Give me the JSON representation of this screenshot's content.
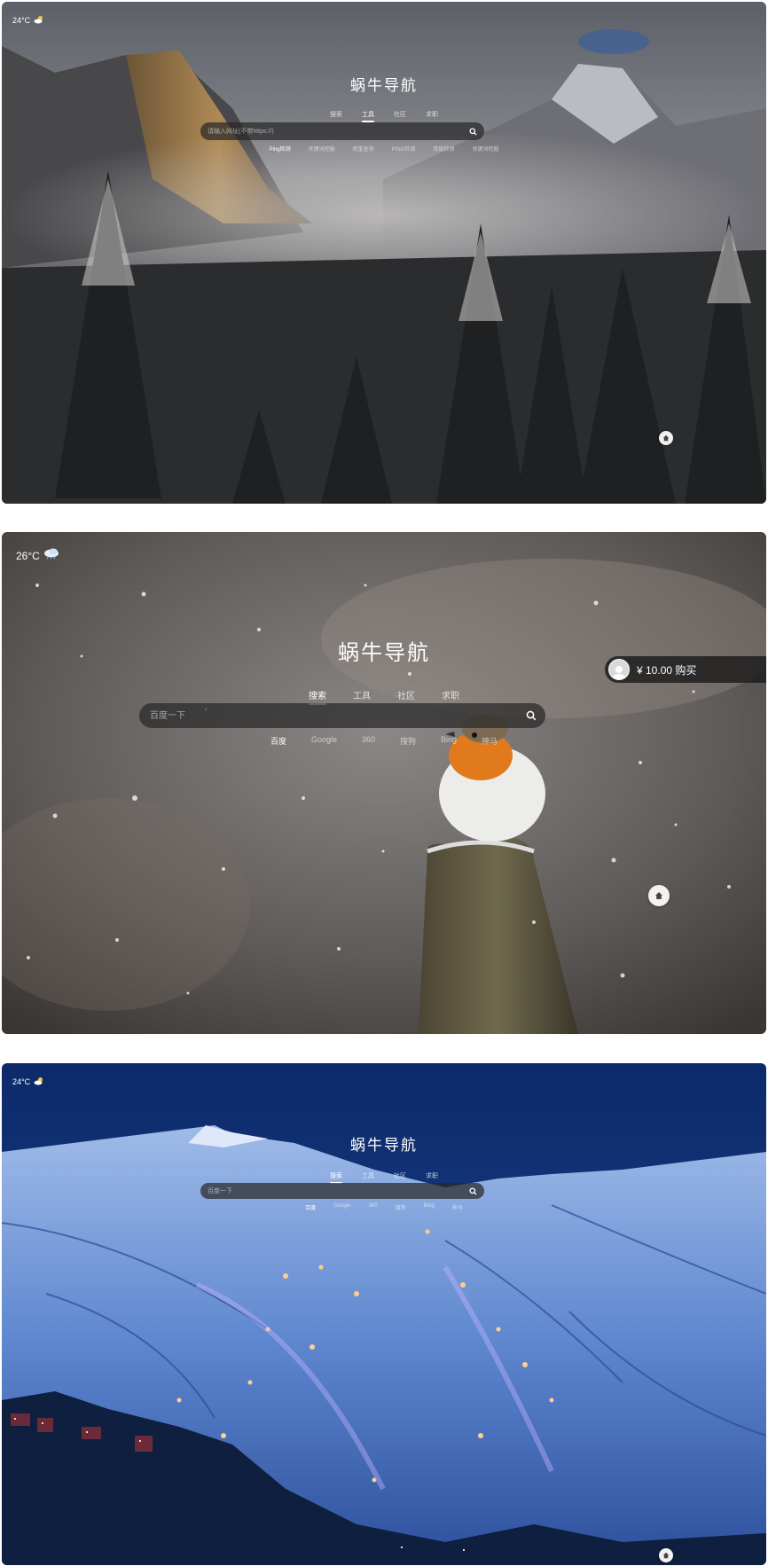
{
  "screens": [
    {
      "weather": {
        "temp": "24°C",
        "icon": "partly-sunny-icon"
      },
      "title": "蜗牛导航",
      "tabs": [
        "搜索",
        "工具",
        "社区",
        "求职"
      ],
      "active_tab": 1,
      "search": {
        "placeholder": "请输入网址(不带https://)"
      },
      "engines": [
        "Ping检测",
        "关键词挖掘",
        "权重查询",
        "PING检测",
        "死链检测",
        "关键词挖掘"
      ],
      "home_icon": "home-icon"
    },
    {
      "weather": {
        "temp": "26°C",
        "icon": "rain-cloud-icon"
      },
      "title": "蜗牛导航",
      "tabs": [
        "搜索",
        "工具",
        "社区",
        "求职"
      ],
      "active_tab": 0,
      "search": {
        "placeholder": "百度一下"
      },
      "engines": [
        "百度",
        "Google",
        "360",
        "搜狗",
        "Bing",
        "神马"
      ],
      "promo": {
        "price": "¥ 10.00 购买"
      },
      "home_icon": "home-icon"
    },
    {
      "weather": {
        "temp": "24°C",
        "icon": "partly-sunny-icon"
      },
      "title": "蜗牛导航",
      "tabs": [
        "搜索",
        "工具",
        "社区",
        "求职"
      ],
      "active_tab": 0,
      "search": {
        "placeholder": "百度一下"
      },
      "engines": [
        "百度",
        "Google",
        "360",
        "搜狗",
        "Bing",
        "神马"
      ],
      "home_icon": "home-icon"
    }
  ]
}
